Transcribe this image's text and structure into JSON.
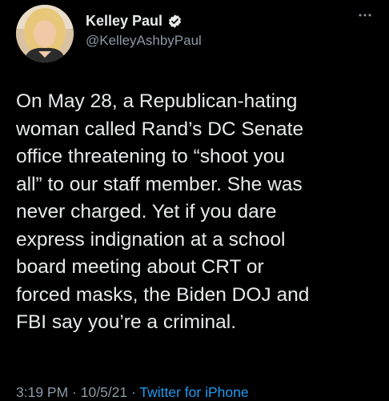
{
  "tweet": {
    "author": {
      "display_name": "Kelley Paul",
      "handle": "@KelleyAshbyPaul",
      "verified_icon": "verified-badge-icon"
    },
    "more_icon": "more-options-icon",
    "text": "On May 28, a Republican-hating\nwoman called Rand’s DC Senate\noffice threatening to “shoot you\nall” to our staff member. She was\nnever charged. Yet if you dare\nexpress indignation at a school\nboard meeting about CRT or\nforced masks, the Biden DOJ and\nFBI say you’re a criminal.",
    "time": "3:19 PM",
    "separator_1": " · ",
    "date": "10/5/21",
    "separator_2": " · ",
    "source": "Twitter for iPhone"
  },
  "colors": {
    "background": "#000000",
    "text": "#e7e9ea",
    "muted": "#8b98a5",
    "accent": "#1d9bf0"
  }
}
